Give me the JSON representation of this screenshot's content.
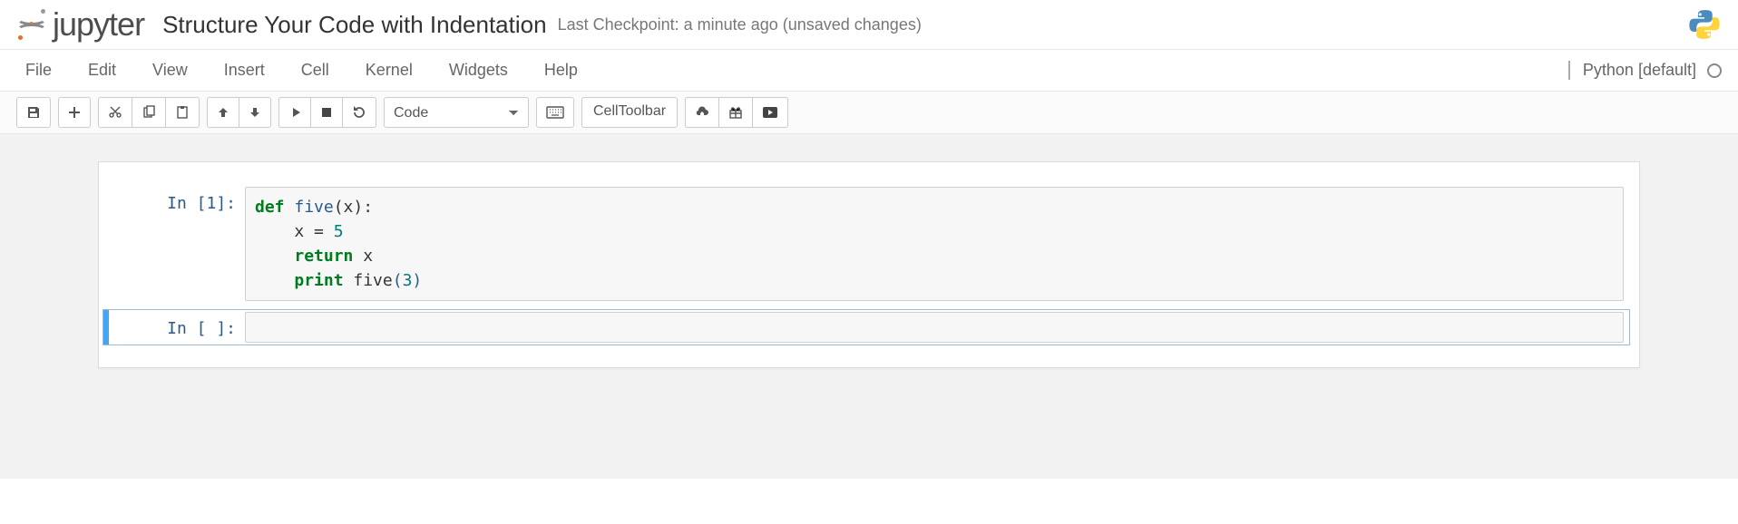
{
  "header": {
    "logo_text": "jupyter",
    "notebook_title": "Structure Your Code with Indentation",
    "checkpoint_text": "Last Checkpoint: a minute ago (unsaved changes)"
  },
  "menu": {
    "items": [
      "File",
      "Edit",
      "View",
      "Insert",
      "Cell",
      "Kernel",
      "Widgets",
      "Help"
    ],
    "kernel_name": "Python [default]"
  },
  "toolbar": {
    "celltype_selected": "Code",
    "celltoolbar_label": "CellToolbar"
  },
  "cells": [
    {
      "prompt": "In [1]:",
      "tokens": [
        {
          "cls": "cm-k",
          "t": "def"
        },
        {
          "cls": "",
          "t": " "
        },
        {
          "cls": "cm-def",
          "t": "five"
        },
        {
          "cls": "",
          "t": "(x):"
        },
        {
          "cls": "",
          "t": "\n"
        },
        {
          "cls": "",
          "t": "    x "
        },
        {
          "cls": "",
          "t": "="
        },
        {
          "cls": "",
          "t": " "
        },
        {
          "cls": "cm-num",
          "t": "5"
        },
        {
          "cls": "",
          "t": "\n"
        },
        {
          "cls": "",
          "t": "    "
        },
        {
          "cls": "cm-k",
          "t": "return"
        },
        {
          "cls": "",
          "t": " x"
        },
        {
          "cls": "",
          "t": "\n"
        },
        {
          "cls": "",
          "t": "    "
        },
        {
          "cls": "cm-builtin",
          "t": "print"
        },
        {
          "cls": "",
          "t": " five"
        },
        {
          "cls": "cm-paren",
          "t": "("
        },
        {
          "cls": "cm-num",
          "t": "3"
        },
        {
          "cls": "cm-paren",
          "t": ")"
        }
      ],
      "selected": false
    },
    {
      "prompt": "In [ ]:",
      "tokens": [],
      "selected": true
    }
  ]
}
